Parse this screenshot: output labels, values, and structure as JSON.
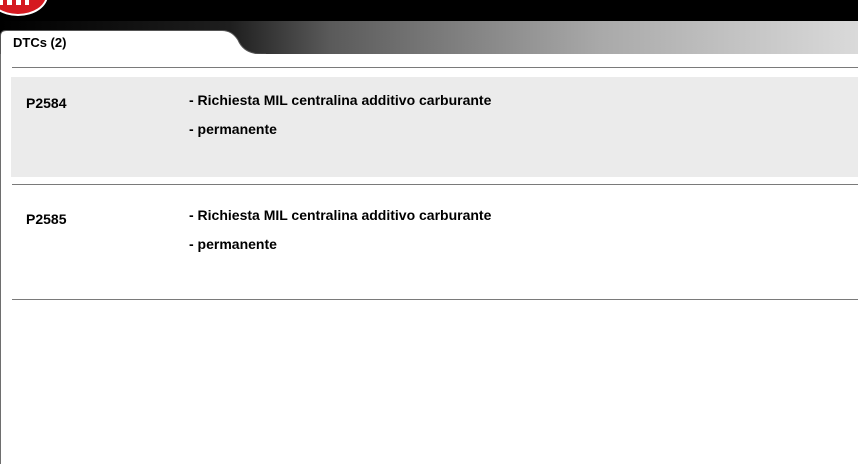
{
  "header": {
    "brand_color": "#d51920",
    "logo_icon": "brand-logo-icon"
  },
  "tab": {
    "label": "DTCs (2)"
  },
  "dtcs": [
    {
      "code": "P2584",
      "description": "- Richiesta MIL centralina additivo carburante",
      "status": "- permanente"
    },
    {
      "code": "P2585",
      "description": "- Richiesta MIL centralina additivo carburante",
      "status": "- permanente"
    }
  ],
  "colors": {
    "row_shade": "#ebebeb",
    "divider": "#7a7a7a"
  }
}
